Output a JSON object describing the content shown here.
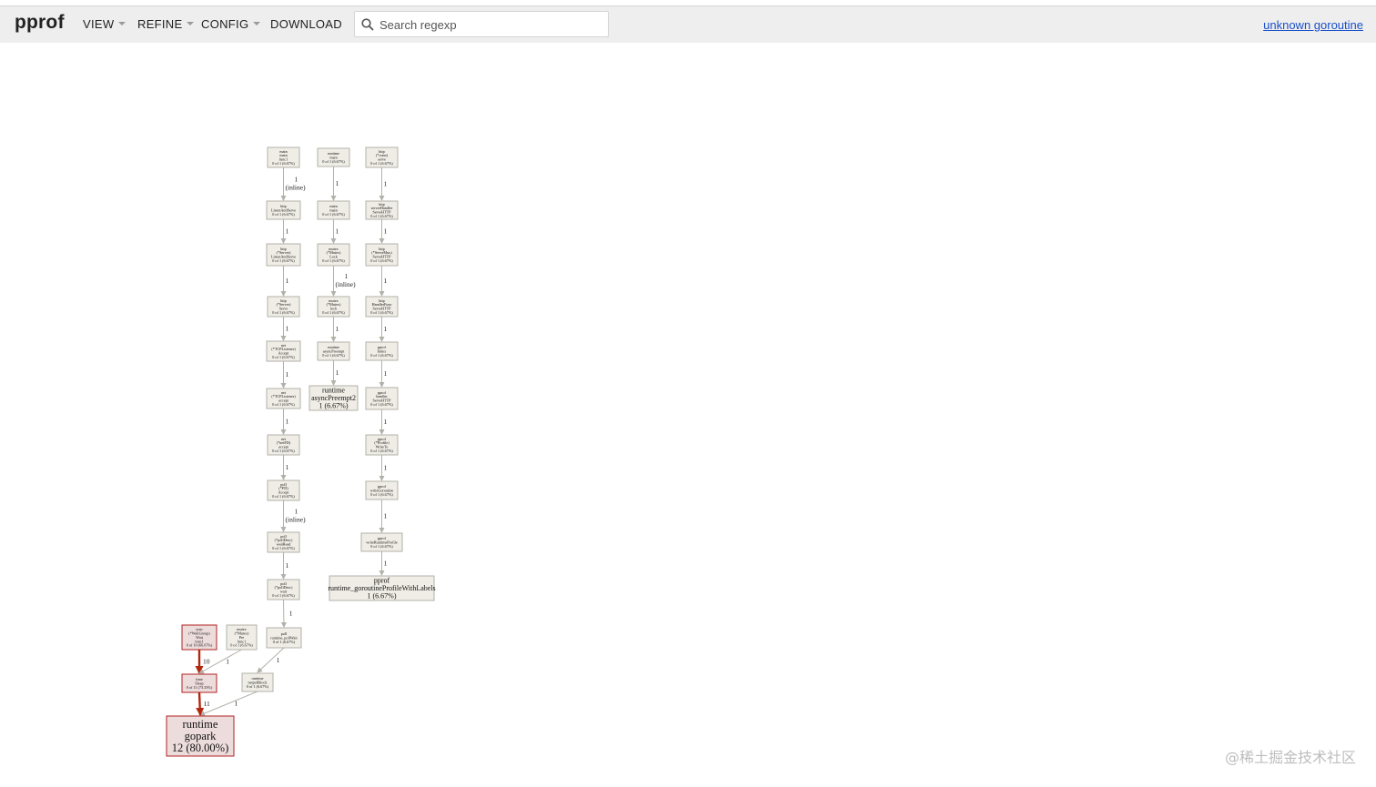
{
  "header": {
    "logo": "pprof",
    "menus": [
      {
        "label": "VIEW",
        "dropdown": true
      },
      {
        "label": "REFINE",
        "dropdown": true
      },
      {
        "label": "CONFIG",
        "dropdown": true
      },
      {
        "label": "DOWNLOAD",
        "dropdown": false
      }
    ],
    "search": {
      "placeholder": "Search regexp",
      "value": ""
    },
    "sample_link": "unknown goroutine"
  },
  "watermark": "@稀土掘金技术社区",
  "graph": {
    "nodes": [
      {
        "id": "n1",
        "lines": [
          "main",
          "main",
          "func1",
          "0 of 1 (6.67%)"
        ],
        "level": "small"
      },
      {
        "id": "n2",
        "lines": [
          "http",
          "ListenAndServe",
          "0 of 1 (6.67%)"
        ],
        "level": "small"
      },
      {
        "id": "n3",
        "lines": [
          "http",
          "(*Server)",
          "ListenAndServe",
          "0 of 1 (6.67%)"
        ],
        "level": "small"
      },
      {
        "id": "n4",
        "lines": [
          "http",
          "(*Server)",
          "Serve",
          "0 of 1 (6.67%)"
        ],
        "level": "small"
      },
      {
        "id": "n5",
        "lines": [
          "net",
          "(*TCPListener)",
          "Accept",
          "0 of 1 (6.67%)"
        ],
        "level": "small"
      },
      {
        "id": "n6",
        "lines": [
          "net",
          "(*TCPListener)",
          "accept",
          "0 of 1 (6.67%)"
        ],
        "level": "small"
      },
      {
        "id": "n7",
        "lines": [
          "net",
          "(*netFD)",
          "accept",
          "0 of 1 (6.67%)"
        ],
        "level": "small"
      },
      {
        "id": "n8",
        "lines": [
          "poll",
          "(*FD)",
          "Accept",
          "0 of 1 (6.67%)"
        ],
        "level": "small"
      },
      {
        "id": "n9",
        "lines": [
          "poll",
          "(*pollDesc)",
          "waitRead",
          "0 of 1 (6.67%)"
        ],
        "level": "small"
      },
      {
        "id": "n10",
        "lines": [
          "poll",
          "(*pollDesc)",
          "wait",
          "0 of 1 (6.67%)"
        ],
        "level": "small"
      },
      {
        "id": "n11",
        "lines": [
          "poll",
          "runtime_pollWait",
          "0 of 1 (6.67%)"
        ],
        "level": "small"
      },
      {
        "id": "n12",
        "lines": [
          "runtime",
          "netpollblock",
          "0 of 1 (6.67%)"
        ],
        "level": "small"
      },
      {
        "id": "r1",
        "lines": [
          "runtime",
          "main",
          "0 of 1 (6.67%)"
        ],
        "level": "small"
      },
      {
        "id": "r2",
        "lines": [
          "main",
          "main",
          "0 of 1 (6.67%)"
        ],
        "level": "small"
      },
      {
        "id": "r3",
        "lines": [
          "mutex",
          "(*Mutex)",
          "Lock",
          "0 of 1 (6.67%)"
        ],
        "level": "small"
      },
      {
        "id": "r4",
        "lines": [
          "mutex",
          "(*Mutex)",
          "lock",
          "0 of 1 (6.67%)"
        ],
        "level": "small"
      },
      {
        "id": "r5",
        "lines": [
          "runtime",
          "asyncPreempt",
          "0 of 1 (6.67%)"
        ],
        "level": "small"
      },
      {
        "id": "r6",
        "lines": [
          "runtime",
          "asyncPreempt2",
          "1 (6.67%)"
        ],
        "level": "medium"
      },
      {
        "id": "p1",
        "lines": [
          "http",
          "(*conn)",
          "serve",
          "0 of 1 (6.67%)"
        ],
        "level": "small"
      },
      {
        "id": "p2",
        "lines": [
          "http",
          "serverHandler",
          "ServeHTTP",
          "0 of 1 (6.67%)"
        ],
        "level": "small"
      },
      {
        "id": "p3",
        "lines": [
          "http",
          "(*ServeMux)",
          "ServeHTTP",
          "0 of 1 (6.67%)"
        ],
        "level": "small"
      },
      {
        "id": "p4",
        "lines": [
          "http",
          "HandlerFunc",
          "ServeHTTP",
          "0 of 1 (6.67%)"
        ],
        "level": "small"
      },
      {
        "id": "p5",
        "lines": [
          "pprof",
          "Index",
          "0 of 1 (6.67%)"
        ],
        "level": "small"
      },
      {
        "id": "p6",
        "lines": [
          "pprof",
          "handler",
          "ServeHTTP",
          "0 of 1 (6.67%)"
        ],
        "level": "small"
      },
      {
        "id": "p7",
        "lines": [
          "pprof",
          "(*Profile)",
          "WriteTo",
          "0 of 1 (6.67%)"
        ],
        "level": "small"
      },
      {
        "id": "p8",
        "lines": [
          "pprof",
          "writeGoroutine",
          "0 of 1 (6.67%)"
        ],
        "level": "small"
      },
      {
        "id": "p9",
        "lines": [
          "pprof",
          "writeRuntimeProfile",
          "0 of 1 (6.67%)"
        ],
        "level": "small"
      },
      {
        "id": "p10",
        "lines": [
          "pprof",
          "runtime_goroutineProfileWithLabels",
          "1 (6.67%)"
        ],
        "level": "medium"
      },
      {
        "id": "s1",
        "lines": [
          "sync",
          "(*WaitGroup)",
          "Wait",
          "func1",
          "0 of 10 (66.67%)"
        ],
        "level": "hot"
      },
      {
        "id": "s2",
        "lines": [
          "mutex",
          "(*Mutex)",
          "Pre",
          "func1",
          "0 of 1 (6.67%)"
        ],
        "level": "small"
      },
      {
        "id": "s3",
        "lines": [
          "time",
          "Sleep",
          "0 of 11 (73.33%)"
        ],
        "level": "hot"
      },
      {
        "id": "gp",
        "lines": [
          "runtime",
          "gopark",
          "12 (80.00%)"
        ],
        "level": "big"
      }
    ],
    "edges": [
      {
        "from": "n1",
        "to": "n2",
        "label": [
          "1",
          "(inline)"
        ],
        "weight": 1
      },
      {
        "from": "n2",
        "to": "n3",
        "label": [
          "1"
        ],
        "weight": 1
      },
      {
        "from": "n3",
        "to": "n4",
        "label": [
          "1"
        ],
        "weight": 1
      },
      {
        "from": "n4",
        "to": "n5",
        "label": [
          "1"
        ],
        "weight": 1
      },
      {
        "from": "n5",
        "to": "n6",
        "label": [
          "1"
        ],
        "weight": 1
      },
      {
        "from": "n6",
        "to": "n7",
        "label": [
          "1"
        ],
        "weight": 1
      },
      {
        "from": "n7",
        "to": "n8",
        "label": [
          "1"
        ],
        "weight": 1
      },
      {
        "from": "n8",
        "to": "n9",
        "label": [
          "1",
          "(inline)"
        ],
        "weight": 1
      },
      {
        "from": "n9",
        "to": "n10",
        "label": [
          "1"
        ],
        "weight": 1
      },
      {
        "from": "n10",
        "to": "n11",
        "label": [
          "1"
        ],
        "weight": 1
      },
      {
        "from": "n11",
        "to": "n12",
        "label": [
          "1"
        ],
        "weight": 1
      },
      {
        "from": "n12",
        "to": "gp",
        "label": [
          "1"
        ],
        "weight": 1
      },
      {
        "from": "r1",
        "to": "r2",
        "label": [
          "1"
        ],
        "weight": 1
      },
      {
        "from": "r2",
        "to": "r3",
        "label": [
          "1"
        ],
        "weight": 1
      },
      {
        "from": "r3",
        "to": "r4",
        "label": [
          "1",
          "(inline)"
        ],
        "weight": 1
      },
      {
        "from": "r4",
        "to": "r5",
        "label": [
          "1"
        ],
        "weight": 1
      },
      {
        "from": "r5",
        "to": "r6",
        "label": [
          "1"
        ],
        "weight": 1
      },
      {
        "from": "p1",
        "to": "p2",
        "label": [
          "1"
        ],
        "weight": 1
      },
      {
        "from": "p2",
        "to": "p3",
        "label": [
          "1"
        ],
        "weight": 1
      },
      {
        "from": "p3",
        "to": "p4",
        "label": [
          "1"
        ],
        "weight": 1
      },
      {
        "from": "p4",
        "to": "p5",
        "label": [
          "1"
        ],
        "weight": 1
      },
      {
        "from": "p5",
        "to": "p6",
        "label": [
          "1"
        ],
        "weight": 1
      },
      {
        "from": "p6",
        "to": "p7",
        "label": [
          "1"
        ],
        "weight": 1
      },
      {
        "from": "p7",
        "to": "p8",
        "label": [
          "1"
        ],
        "weight": 1
      },
      {
        "from": "p8",
        "to": "p9",
        "label": [
          "1"
        ],
        "weight": 1
      },
      {
        "from": "p9",
        "to": "p10",
        "label": [
          "1"
        ],
        "weight": 1
      },
      {
        "from": "s1",
        "to": "s3",
        "label": [
          "10"
        ],
        "weight": 10
      },
      {
        "from": "s2",
        "to": "s3",
        "label": [
          "1"
        ],
        "weight": 1
      },
      {
        "from": "s3",
        "to": "gp",
        "label": [
          "11"
        ],
        "weight": 11
      }
    ]
  },
  "colors": {
    "node_fill": "#f0ede6",
    "node_stroke": "#b2b1a9",
    "hot_fill": "#eddcdc",
    "hot_stroke": "#b22222",
    "edge_gray": "#b2b1a9",
    "edge_hot": "#b2260e",
    "link": "#1a4fc9"
  }
}
